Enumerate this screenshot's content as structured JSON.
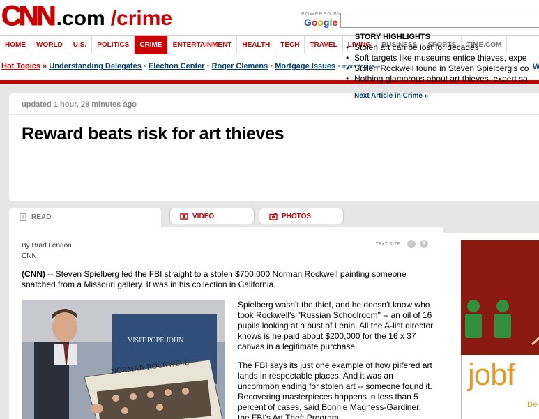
{
  "header": {
    "logo_cnn": "CNN",
    "logo_dotcom": ".com",
    "logo_section": "/crime",
    "powered_by": "POWERED BY",
    "google": [
      "G",
      "o",
      "o",
      "g",
      "l",
      "e"
    ]
  },
  "nav": {
    "items": [
      {
        "label": "HOME"
      },
      {
        "label": "WORLD"
      },
      {
        "label": "U.S."
      },
      {
        "label": "POLITICS"
      },
      {
        "label": "CRIME"
      },
      {
        "label": "ENTERTAINMENT"
      },
      {
        "label": "HEALTH"
      },
      {
        "label": "TECH"
      },
      {
        "label": "TRAVEL"
      },
      {
        "label": "LIVING"
      },
      {
        "label": "BUSINESS"
      },
      {
        "label": "SPORTS"
      },
      {
        "label": "TIME.COM"
      }
    ],
    "active": "CRIME"
  },
  "hot_topics": {
    "label": "Hot Topics",
    "sep": "»",
    "links": [
      "Understanding Delegates",
      "Election Center",
      "Roger Clemens",
      "Mortgage Issues"
    ],
    "more": "more topics »",
    "cut_off": "W"
  },
  "story": {
    "updated": "updated 1 hour, 28 minutes ago",
    "headline": "Reward beats risk for art thieves",
    "highlights_title": "STORY HIGHLIGHTS",
    "highlights": [
      "Stolen art can be lost for decades",
      "Soft targets like museums entice thieves, expe",
      "Stolen Rockwell found in Steven Spielberg's co",
      "Nothing glamorous about art thieves, expert sa"
    ],
    "next_article": "Next Article in Crime »"
  },
  "tabs": {
    "read": "READ",
    "video": "VIDEO",
    "photos": "PHOTOS"
  },
  "article": {
    "byline": "By Brad Lendon",
    "source": "CNN",
    "text_size": "TEXT SIZE",
    "text_size_minus": "−",
    "text_size_plus": "+",
    "lede_tag": "(CNN)",
    "lede": " -- Steven Spielberg led the FBI straight to a stolen $700,000 Norman Rockwell painting someone snatched from a Missouri gallery. It was in his collection in California.",
    "para1": "Spielberg wasn't the thief, and he doesn't know who took Rockwell's \"Russian Schoolroom\" -- an oil of 16 pupils looking at a bust of Lenin. All the A-list director knows is he paid about $200,000 for the 16 x 37 canvas in a legitimate purchase.",
    "para2": "The FBI says its just one example of how pilfered art lands in respectable places. And it was an uncommon ending for stolen art -- someone found it. Recovering masterpieces happens in less than 5 percent of cases, said Bonnie Magness-Gardiner, the FBI's Art Theft Program",
    "photo_caption_text": "NORMAN ROCKWELL",
    "photo_sign_text": "VISIT POPE JOHN"
  },
  "ad": {
    "word": "jobf",
    "sub": "Be"
  },
  "colors": {
    "brand_red": "#cc0000",
    "link_blue": "#004276",
    "page_gray": "#e6e6e6"
  }
}
